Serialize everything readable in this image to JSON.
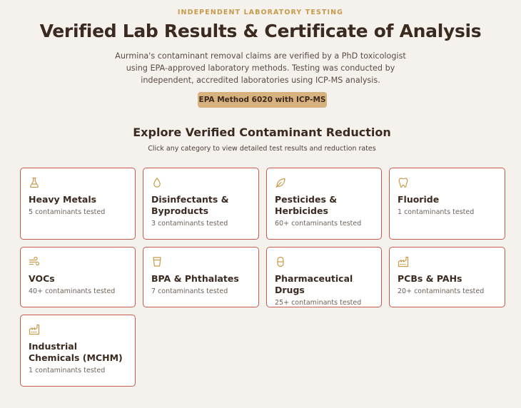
{
  "header": {
    "eyebrow": "INDEPENDENT LABORATORY TESTING",
    "title": "Verified Lab Results & Certificate of Analysis",
    "description": "Aurmina's contaminant removal claims are verified by a PhD toxicologist using EPA-approved laboratory methods. Testing was conducted by independent, accredited laboratories using ICP-MS analysis.",
    "badge": "EPA Method 6020 with ICP-MS"
  },
  "section": {
    "title": "Explore Verified Contaminant Reduction",
    "subtitle": "Click any category to view detailed test results and reduction rates"
  },
  "colors": {
    "accent": "#c79a4b",
    "badge_bg": "#d7b17e",
    "card_border": "#c85a4d",
    "background": "#f5f1ed",
    "heading": "#3b2a20"
  },
  "categories": [
    {
      "name": "Heavy Metals",
      "count": "5 contaminants tested",
      "icon": "flask-icon"
    },
    {
      "name": "Disinfectants & Byproducts",
      "count": "3 contaminants tested",
      "icon": "droplet-icon"
    },
    {
      "name": "Pesticides & Herbicides",
      "count": "60+ contaminants tested",
      "icon": "leaf-icon"
    },
    {
      "name": "Fluoride",
      "count": "1 contaminants tested",
      "icon": "tooth-icon"
    },
    {
      "name": "VOCs",
      "count": "40+ contaminants tested",
      "icon": "wind-icon"
    },
    {
      "name": "BPA & Phthalates",
      "count": "7 contaminants tested",
      "icon": "cup-icon"
    },
    {
      "name": "Pharmaceutical Drugs",
      "count": "25+ contaminants tested",
      "icon": "pill-icon"
    },
    {
      "name": "PCBs & PAHs",
      "count": "20+ contaminants tested",
      "icon": "factory-icon"
    },
    {
      "name": "Industrial Chemicals (MCHM)",
      "count": "1 contaminants tested",
      "icon": "factory-icon"
    }
  ]
}
